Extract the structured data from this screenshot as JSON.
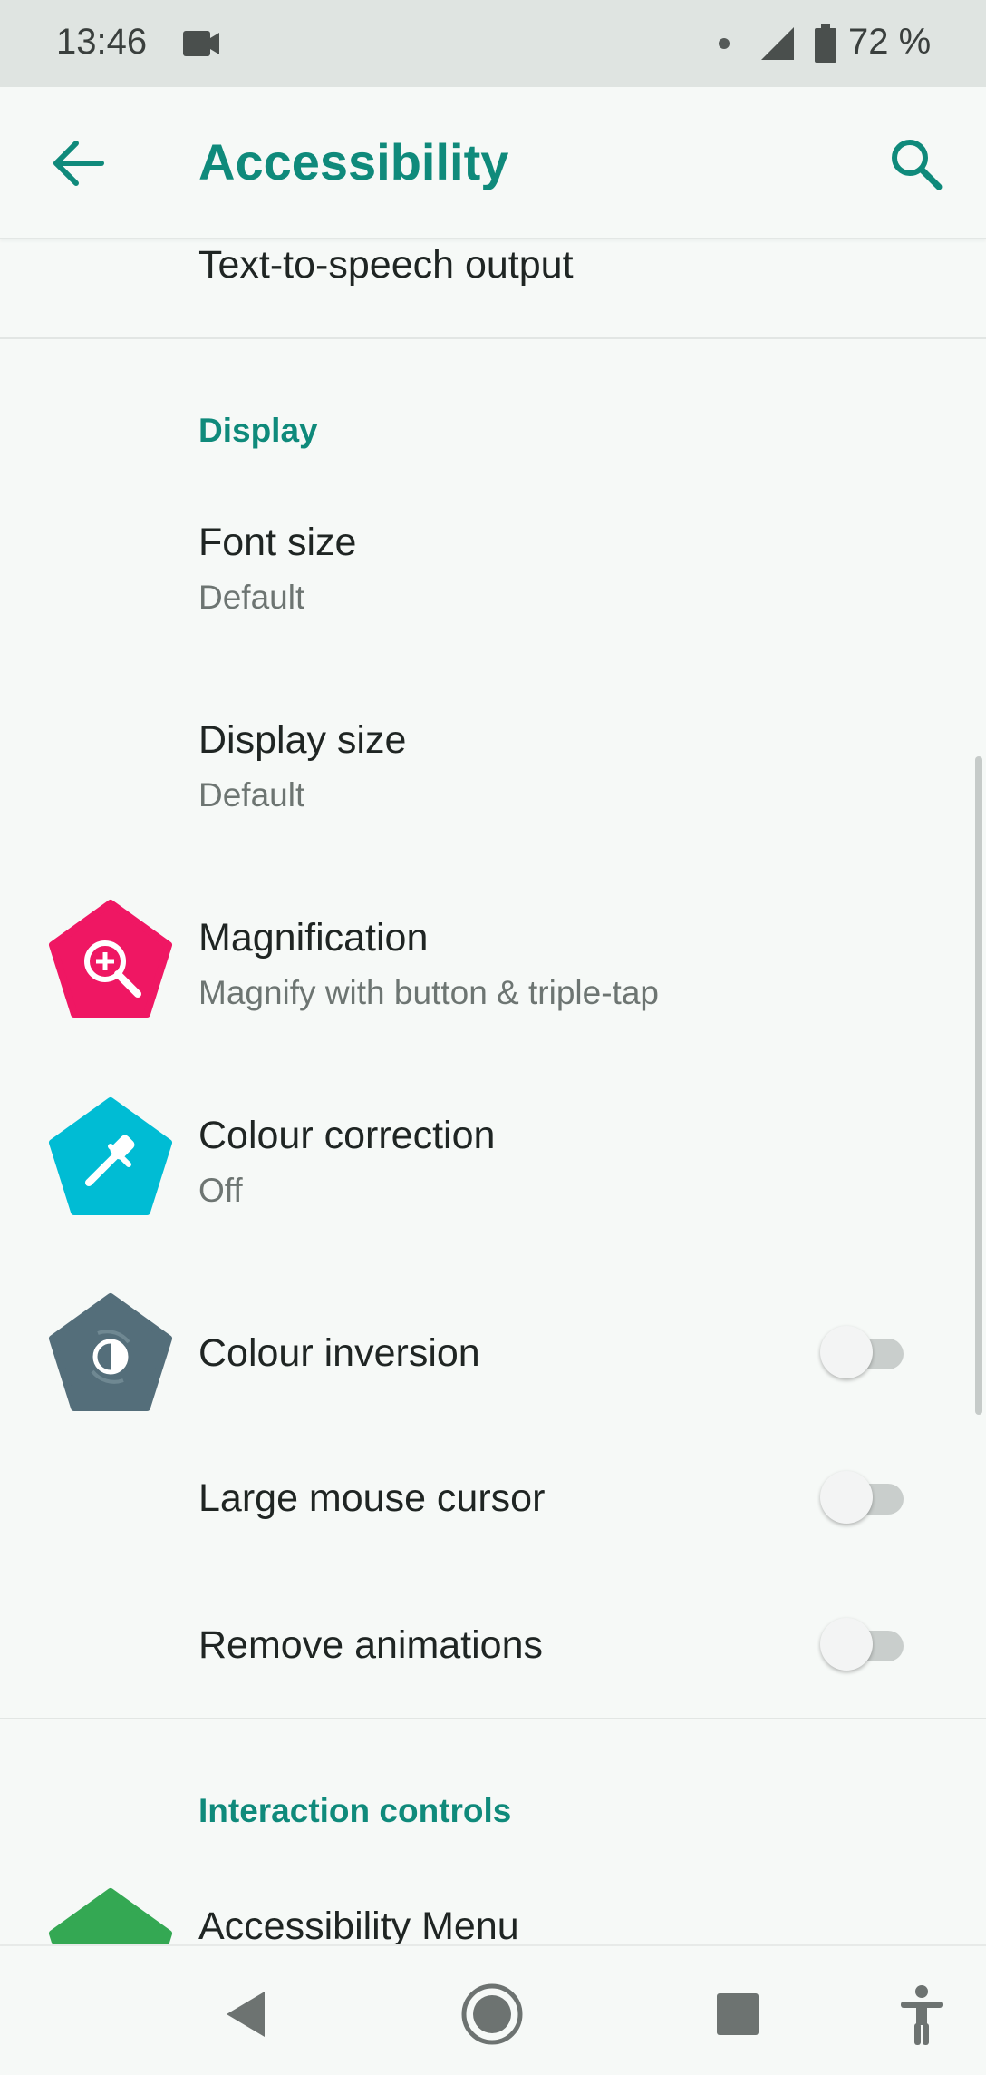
{
  "status_bar": {
    "time": "13:46",
    "battery_percent": "72 %",
    "icons": [
      "video-camera-icon",
      "notification-dot-icon",
      "signal-icon",
      "battery-icon"
    ]
  },
  "app_bar": {
    "title": "Accessibility",
    "back_icon": "arrow-left-icon",
    "search_icon": "search-icon"
  },
  "list": {
    "top_item": {
      "title": "Text-to-speech output"
    },
    "display_section": {
      "header": "Display",
      "font_size": {
        "title": "Font size",
        "summary": "Default"
      },
      "display_size": {
        "title": "Display size",
        "summary": "Default"
      },
      "magnification": {
        "title": "Magnification",
        "summary": "Magnify with button & triple-tap",
        "icon": "magnification-icon",
        "color": "#ef1763"
      },
      "colour_correction": {
        "title": "Colour correction",
        "summary": "Off",
        "icon": "eyedropper-icon",
        "color": "#00bcd4"
      },
      "colour_inversion": {
        "title": "Colour inversion",
        "enabled": false,
        "icon": "colour-inversion-icon",
        "color": "#546e7a"
      },
      "large_mouse_cursor": {
        "title": "Large mouse cursor",
        "enabled": false
      },
      "remove_animations": {
        "title": "Remove animations",
        "enabled": false
      }
    },
    "interaction_section": {
      "header": "Interaction controls",
      "accessibility_menu": {
        "title": "Accessibility Menu",
        "color": "#34a853"
      }
    }
  },
  "nav_bar": {
    "icons": [
      "back-triangle-icon",
      "home-circle-icon",
      "recents-square-icon",
      "accessibility-person-icon"
    ]
  },
  "colors": {
    "accent": "#0f8a7b",
    "background": "#f6f9f7",
    "status_bar": "#dfe4e1"
  }
}
